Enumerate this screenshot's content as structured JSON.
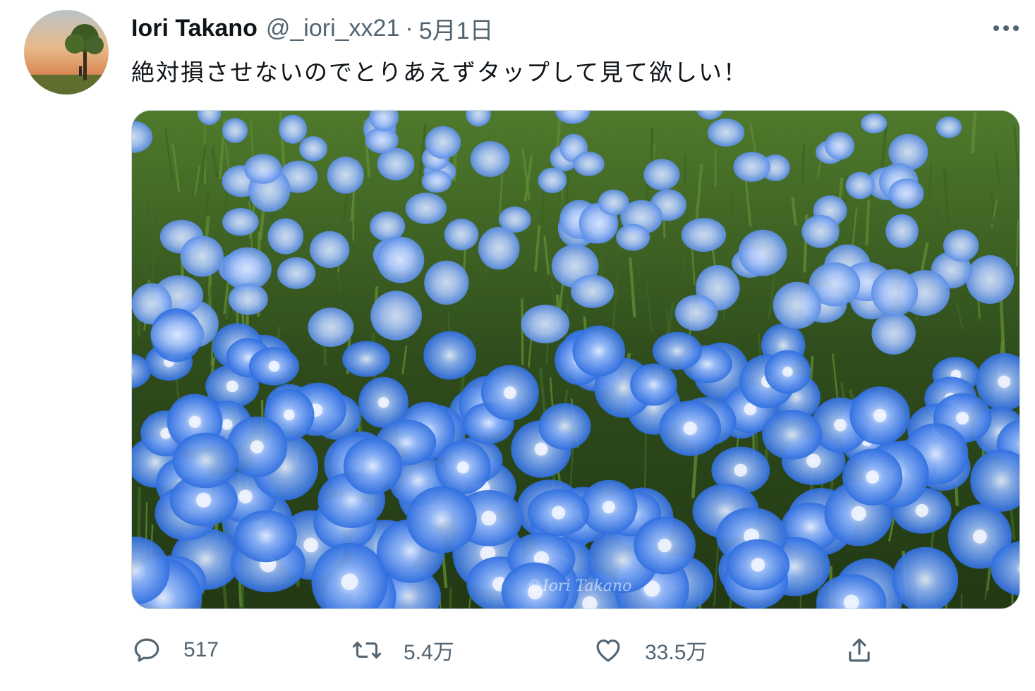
{
  "author": {
    "name": "Iori Takano",
    "handle": "@_iori_xx21",
    "separator": "·",
    "date": "5月1日"
  },
  "tweet": {
    "text": "絶対損させないのでとりあえずタップして見て欲しい！"
  },
  "media": {
    "watermark": "©Iori Takano",
    "description_icon": "photo"
  },
  "actions": {
    "reply_count": "517",
    "retweet_count": "5.4万",
    "like_count": "33.5万"
  },
  "icons": {
    "more": "more-horizontal-icon",
    "reply": "reply-icon",
    "retweet": "retweet-icon",
    "like": "heart-icon",
    "share": "share-icon"
  },
  "colors": {
    "text": "#0f1419",
    "secondary": "#536471",
    "border": "#cfd9de"
  }
}
